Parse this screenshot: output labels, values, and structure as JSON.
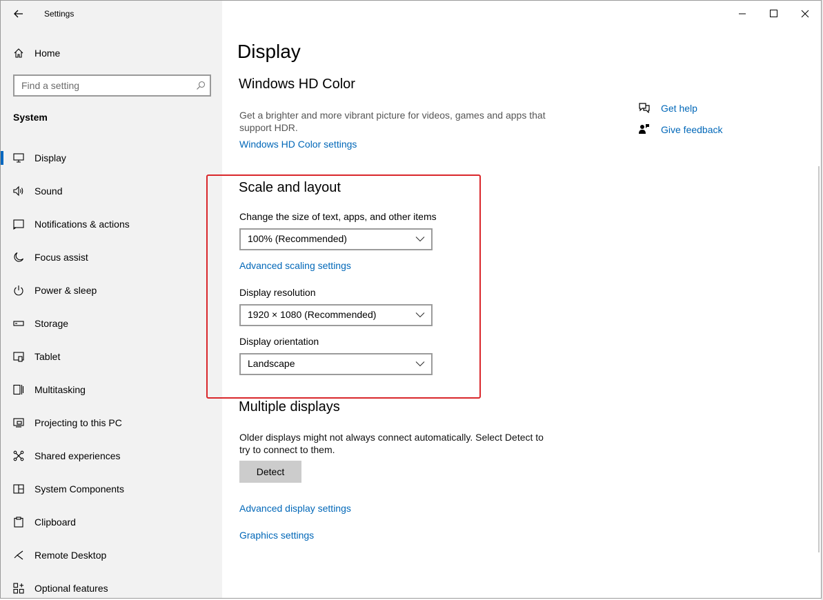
{
  "window": {
    "title": "Settings"
  },
  "sidebar": {
    "home_label": "Home",
    "search_placeholder": "Find a setting",
    "section_title": "System",
    "items": [
      {
        "label": "Display",
        "icon": "monitor-icon",
        "active": true
      },
      {
        "label": "Sound",
        "icon": "speaker-icon"
      },
      {
        "label": "Notifications & actions",
        "icon": "notification-icon"
      },
      {
        "label": "Focus assist",
        "icon": "moon-icon"
      },
      {
        "label": "Power & sleep",
        "icon": "power-icon"
      },
      {
        "label": "Storage",
        "icon": "storage-icon"
      },
      {
        "label": "Tablet",
        "icon": "tablet-icon"
      },
      {
        "label": "Multitasking",
        "icon": "multitasking-icon"
      },
      {
        "label": "Projecting to this PC",
        "icon": "projector-icon"
      },
      {
        "label": "Shared experiences",
        "icon": "shared-icon"
      },
      {
        "label": "System Components",
        "icon": "components-icon"
      },
      {
        "label": "Clipboard",
        "icon": "clipboard-icon"
      },
      {
        "label": "Remote Desktop",
        "icon": "remote-desktop-icon"
      },
      {
        "label": "Optional features",
        "icon": "optional-features-icon"
      }
    ]
  },
  "main": {
    "page_title": "Display",
    "hd_color": {
      "heading": "Windows HD Color",
      "description": "Get a brighter and more vibrant picture for videos, games and apps that support HDR.",
      "link": "Windows HD Color settings"
    },
    "scale_layout": {
      "heading": "Scale and layout",
      "scale_label": "Change the size of text, apps, and other items",
      "scale_value": "100% (Recommended)",
      "advanced_scaling_link": "Advanced scaling settings",
      "resolution_label": "Display resolution",
      "resolution_value": "1920 × 1080 (Recommended)",
      "orientation_label": "Display orientation",
      "orientation_value": "Landscape"
    },
    "multiple_displays": {
      "heading": "Multiple displays",
      "description": "Older displays might not always connect automatically. Select Detect to try to connect to them.",
      "detect_label": "Detect"
    },
    "advanced_display_link": "Advanced display settings",
    "graphics_link": "Graphics settings"
  },
  "help": {
    "get_help": "Get help",
    "give_feedback": "Give feedback"
  },
  "colors": {
    "accent": "#0067b8",
    "highlight_border": "#d9262a",
    "sidebar_bg": "#f2f2f2"
  }
}
